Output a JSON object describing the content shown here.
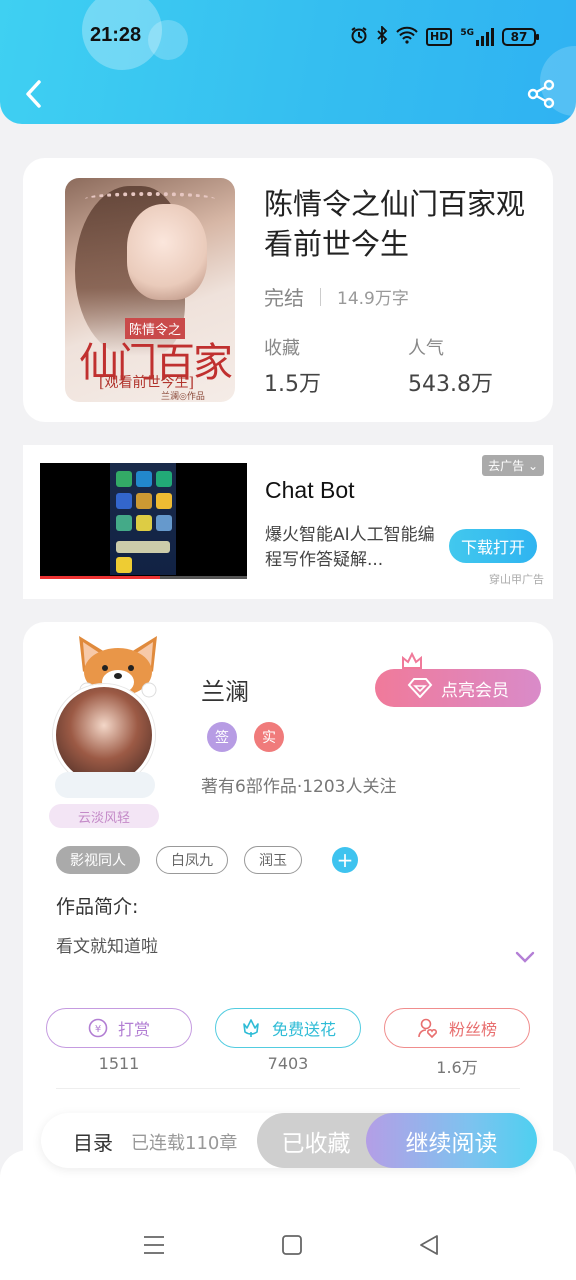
{
  "status_bar": {
    "time": "21:28",
    "hd_label": "HD",
    "network_label": "5G",
    "battery": "87",
    "icons": [
      "alarm-icon",
      "bluetooth-icon",
      "wifi-icon",
      "hd-icon",
      "signal-icon",
      "battery-icon"
    ]
  },
  "header": {
    "back_icon": "chevron-left-icon",
    "share_icon": "share-icon",
    "accent": "#35bef0"
  },
  "book": {
    "title": "陈情令之仙门百家观看前世今生",
    "status": "完结",
    "word_count": "14.9万字",
    "favorites_label": "收藏",
    "favorites_value": "1.5万",
    "popularity_label": "人气",
    "popularity_value": "543.8万",
    "cover": {
      "small_title": "陈情令之",
      "big_title": "仙门百家",
      "subtitle": "[观看前世今生]",
      "author_line": "兰澜◎作品"
    }
  },
  "ad": {
    "title": "Chat Bot",
    "description": "爆火智能AI人工智能编程写作答疑解...",
    "close_label": "去广告",
    "button_label": "下载打开",
    "source": "穿山甲广告"
  },
  "author": {
    "name": "兰澜",
    "frame_label": "云淡风轻",
    "vip_label": "点亮会员",
    "badge_sign": "签",
    "badge_real": "实",
    "info": "著有6部作品·1203人关注"
  },
  "tags": [
    "影视同人",
    "白凤九",
    "润玉"
  ],
  "intro": {
    "title": "作品简介:",
    "text": "看文就知道啦"
  },
  "actions": {
    "reward_label": "打赏",
    "reward_count": "1511",
    "flower_label": "免费送花",
    "flower_count": "7403",
    "fans_label": "粉丝榜",
    "fans_count": "1.6万"
  },
  "bottom_bar": {
    "toc_label": "目录",
    "serial_label": "已连载110章",
    "collected_label": "已收藏",
    "read_label": "继续阅读"
  },
  "system_nav": [
    "menu-icon",
    "home-icon",
    "back-icon"
  ]
}
